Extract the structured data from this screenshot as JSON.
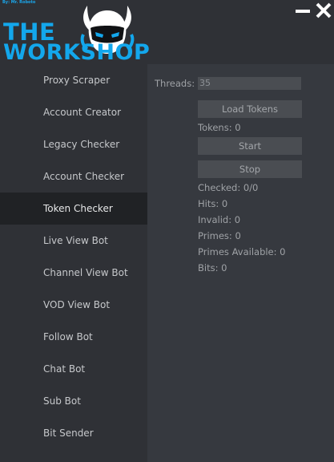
{
  "header": {
    "credit": "By: Mr. Roboto",
    "logo_line1": "THE",
    "logo_line2": "WORKSHOP",
    "minimize_icon": "minimize-icon",
    "close_icon": "close-icon",
    "accent_color": "#13a7ec"
  },
  "sidebar": {
    "items": [
      {
        "label": "Proxy Scraper"
      },
      {
        "label": "Account Creator"
      },
      {
        "label": "Legacy Checker"
      },
      {
        "label": "Account Checker"
      },
      {
        "label": "Token Checker",
        "active": true
      },
      {
        "label": "Live View Bot"
      },
      {
        "label": "Channel View Bot"
      },
      {
        "label": "VOD View Bot"
      },
      {
        "label": "Follow Bot"
      },
      {
        "label": "Chat Bot"
      },
      {
        "label": "Sub Bot"
      },
      {
        "label": "Bit Sender"
      }
    ]
  },
  "panel": {
    "threads_label": "Threads:",
    "threads_value": "35",
    "load_tokens_label": "Load Tokens",
    "tokens_text": "Tokens: 0",
    "start_label": "Start",
    "stop_label": "Stop",
    "stats": [
      "Checked: 0/0",
      "Hits: 0",
      "Invalid: 0",
      "Primes: 0",
      "Primes Available: 0",
      "Bits: 0"
    ]
  }
}
